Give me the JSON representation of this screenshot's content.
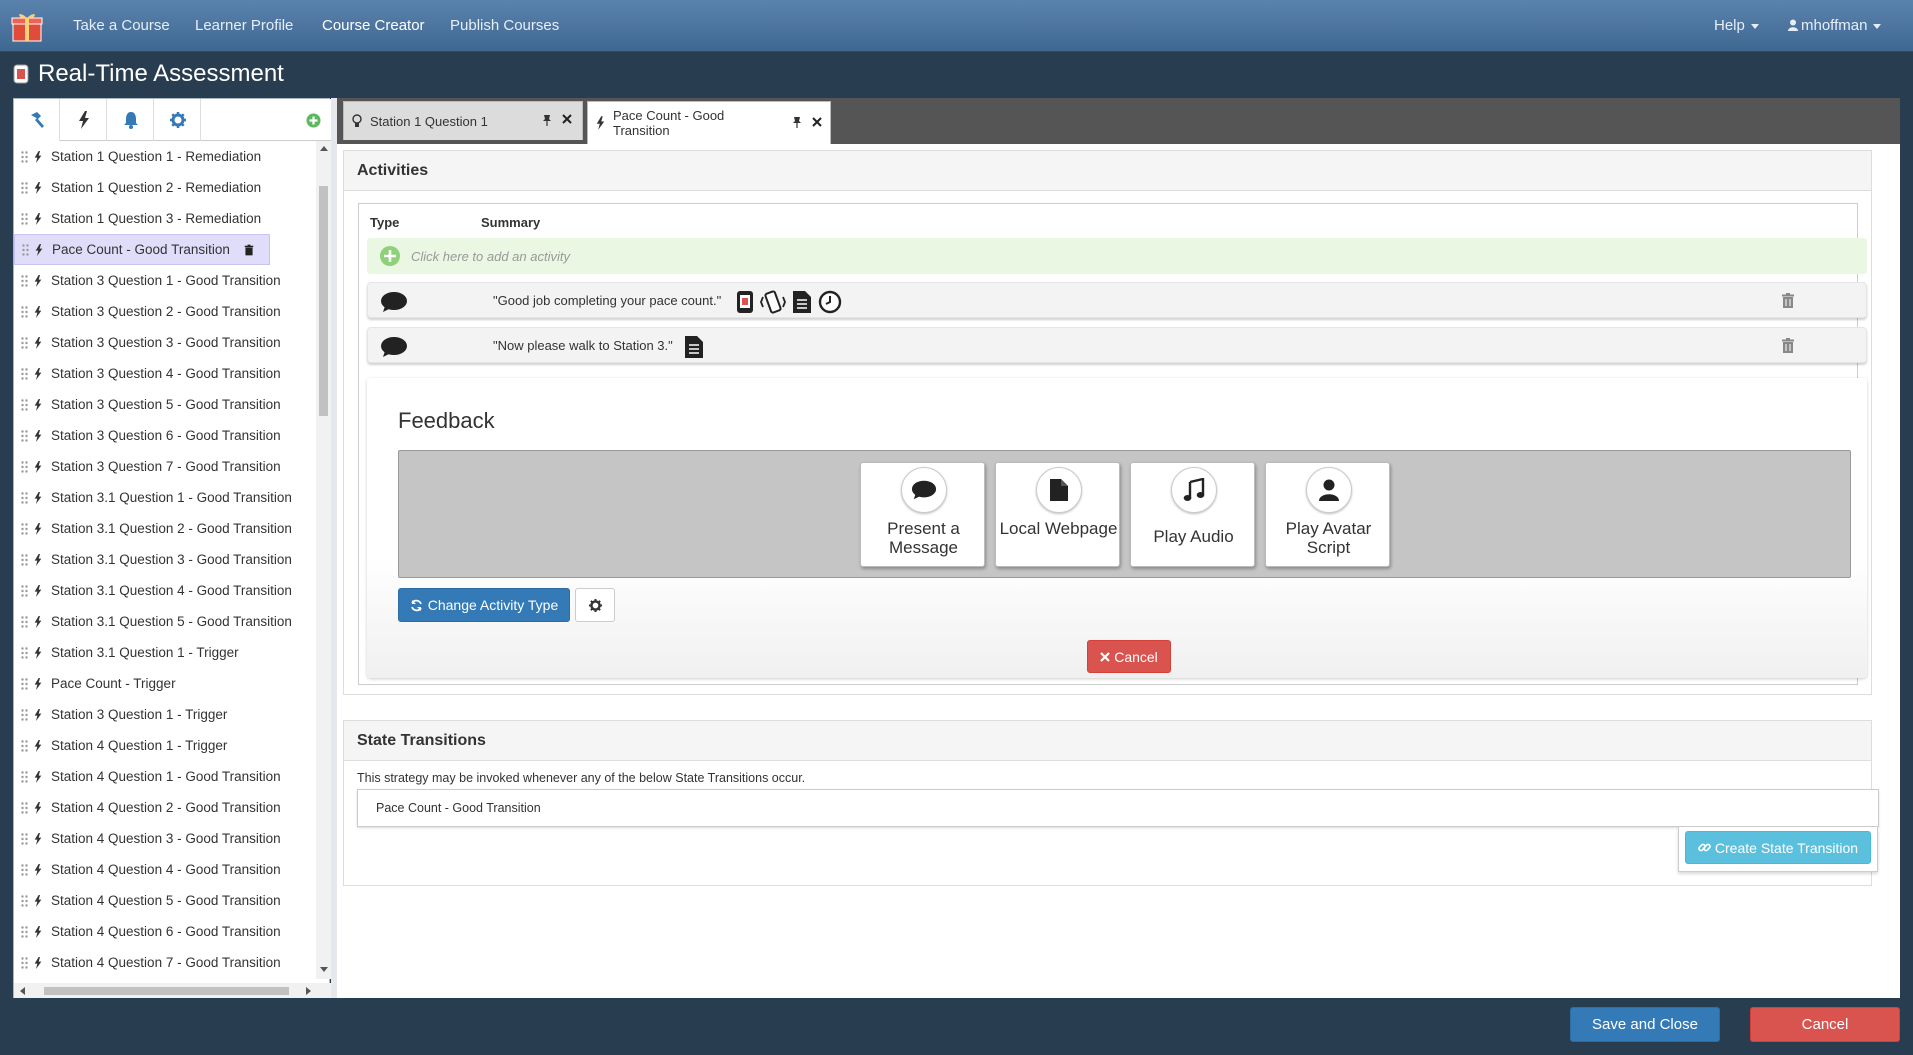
{
  "topnav": {
    "items": [
      "Take a Course",
      "Learner Profile",
      "Course Creator",
      "Publish Courses"
    ],
    "active": "Course Creator",
    "help_label": "Help",
    "user_label": "mhoffman"
  },
  "modal": {
    "title": "Real-Time Assessment"
  },
  "toolbar": {
    "icons": [
      "hammer-icon",
      "bolt-icon",
      "bell-icon",
      "gear-icon",
      "add-circle-icon"
    ]
  },
  "sidebar": {
    "items": [
      {
        "label": "Station 1 Question 1 - Remediation"
      },
      {
        "label": "Station 1 Question 2 - Remediation"
      },
      {
        "label": "Station 1 Question 3 - Remediation"
      },
      {
        "label": "Pace Count - Good Transition",
        "selected": true
      },
      {
        "label": "Station 3 Question 1 - Good Transition"
      },
      {
        "label": "Station 3 Question 2 - Good Transition"
      },
      {
        "label": "Station 3 Question 3 - Good Transition"
      },
      {
        "label": "Station 3 Question 4 - Good Transition"
      },
      {
        "label": "Station 3 Question 5 - Good Transition"
      },
      {
        "label": "Station 3 Question 6 - Good Transition"
      },
      {
        "label": "Station 3 Question 7 - Good Transition"
      },
      {
        "label": "Station 3.1 Question 1 - Good Transition"
      },
      {
        "label": "Station 3.1 Question 2 - Good Transition"
      },
      {
        "label": "Station 3.1 Question 3 - Good Transition"
      },
      {
        "label": "Station 3.1 Question 4 - Good Transition"
      },
      {
        "label": "Station 3.1 Question 5 - Good Transition"
      },
      {
        "label": "Station 3.1 Question 1 - Trigger"
      },
      {
        "label": "Pace Count - Trigger"
      },
      {
        "label": "Station 3 Question 1 - Trigger"
      },
      {
        "label": "Station 4 Question 1 - Trigger"
      },
      {
        "label": "Station 4 Question 1 - Good Transition"
      },
      {
        "label": "Station 4 Question 2 - Good Transition"
      },
      {
        "label": "Station 4 Question 3 - Good Transition"
      },
      {
        "label": "Station 4 Question 4 - Good Transition"
      },
      {
        "label": "Station 4 Question 5 - Good Transition"
      },
      {
        "label": "Station 4 Question 6 - Good Transition"
      },
      {
        "label": "Station 4 Question 7 - Good Transition"
      }
    ]
  },
  "tabs": [
    {
      "label": "Station 1 Question 1",
      "icon": "lightbulb-icon",
      "active": false
    },
    {
      "label": "Pace Count - Good Transition",
      "icon": "bolt-icon",
      "active": true
    }
  ],
  "activities": {
    "header": "Activities",
    "col_type": "Type",
    "col_summary": "Summary",
    "add_placeholder": "Click here to add an activity",
    "rows": [
      {
        "summary": "\"Good job completing your pace count.\"",
        "icons": [
          "tablet-icon",
          "vibrate-icon",
          "document-icon",
          "clock-icon"
        ]
      },
      {
        "summary": "\"Now please walk to Station 3.\"",
        "icons": [
          "document-icon"
        ]
      }
    ]
  },
  "feedback": {
    "title": "Feedback",
    "choices": [
      {
        "label": "Present a Message",
        "icon": "comment-icon"
      },
      {
        "label": "Local Webpage",
        "icon": "file-icon"
      },
      {
        "label": "Play Audio",
        "icon": "music-icon"
      },
      {
        "label": "Play Avatar Script",
        "icon": "user-icon"
      }
    ],
    "change_type_label": "Change Activity Type",
    "cancel_label": "Cancel"
  },
  "state_transitions": {
    "header": "State Transitions",
    "description": "This strategy may be invoked whenever any of the below State Transitions occur.",
    "items": [
      "Pace Count - Good Transition"
    ],
    "create_label": "Create State Transition"
  },
  "footer": {
    "save_label": "Save and Close",
    "cancel_label": "Cancel"
  },
  "colors": {
    "primary": "#337ab7",
    "danger": "#d9534f",
    "info": "#5bc0de",
    "success": "#5cb85c",
    "selected_row": "#e0ddfa"
  }
}
